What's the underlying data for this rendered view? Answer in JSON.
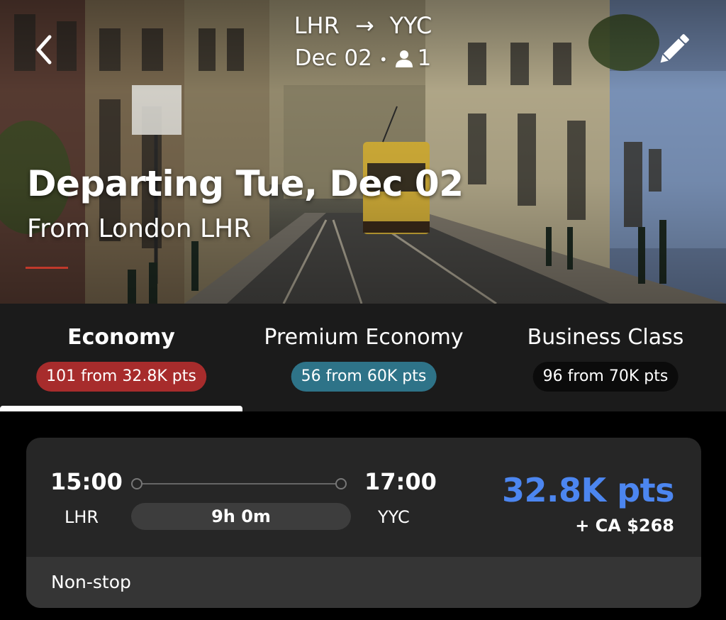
{
  "header": {
    "origin": "LHR",
    "destination": "YYC",
    "date": "Dec 02",
    "passengers": "1",
    "back_icon": "chevron-left-icon",
    "edit_icon": "pencil-icon",
    "person_icon": "person-icon"
  },
  "hero": {
    "title": "Departing Tue, Dec 02",
    "subtitle": "From London LHR"
  },
  "tabs": [
    {
      "label": "Economy",
      "badge": "101 from 32.8K pts",
      "badge_color": "#a72c2c",
      "active": true
    },
    {
      "label": "Premium Economy",
      "badge": "56 from 60K pts",
      "badge_color": "#2e7388",
      "active": false
    },
    {
      "label": "Business Class",
      "badge": "96 from 70K pts",
      "badge_color": "#0b0b0b",
      "active": false
    }
  ],
  "flight": {
    "depart_time": "15:00",
    "depart_airport": "LHR",
    "arrive_time": "17:00",
    "arrive_airport": "YYC",
    "duration": "9h 0m",
    "points": "32.8K pts",
    "cash": "+ CA $268",
    "stops": "Non-stop",
    "points_color": "#4c86f0"
  }
}
